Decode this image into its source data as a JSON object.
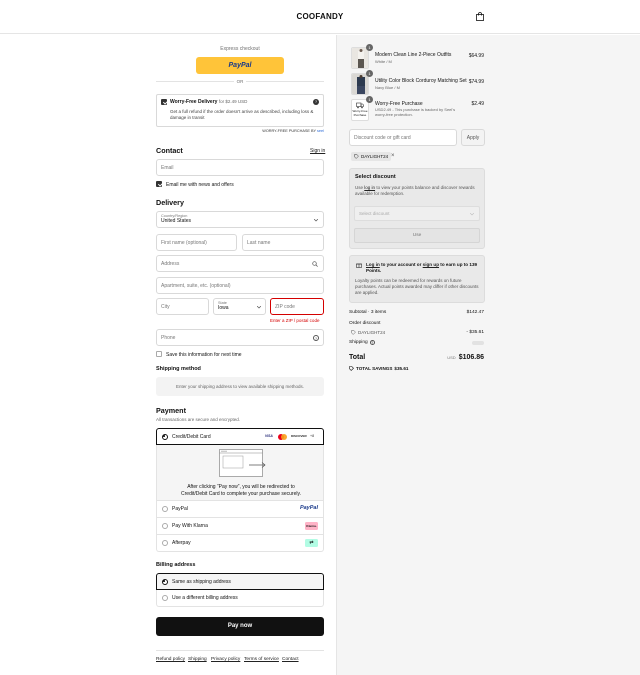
{
  "header": {
    "brand": "COOFANDY",
    "cart_icon": "shopping-bag-icon"
  },
  "express": {
    "label": "Express checkout",
    "paypal_label": "PayPal",
    "or": "OR"
  },
  "worry": {
    "title": "Worry-Free Delivery",
    "price": "for $2.49 USD",
    "desc": "Get a full refund if the order doesn't arrive as described, including loss & damage in transit",
    "powered": "WORRY-FREE PURCHASE BY",
    "seel": "seel",
    "checked": true
  },
  "contact": {
    "title": "Contact",
    "signin": "Sign in",
    "email_placeholder": "Email",
    "news_label": "Email me with news and offers",
    "news_checked": true
  },
  "delivery": {
    "title": "Delivery",
    "country_label": "Country/Region",
    "country_value": "United States",
    "first_name": "First name (optional)",
    "last_name": "Last name",
    "address": "Address",
    "apartment": "Apartment, suite, etc. (optional)",
    "city": "City",
    "state_label": "State",
    "state_value": "Iowa",
    "zip": "ZIP code",
    "zip_error": "Enter a ZIP / postal code",
    "phone": "Phone",
    "save_label": "Save this information for next time"
  },
  "shipping": {
    "title": "Shipping method",
    "message": "Enter your shipping address to view available shipping methods."
  },
  "payment": {
    "title": "Payment",
    "subtitle": "All transactions are secure and encrypted.",
    "card_label": "Credit/Debit Card",
    "card_badges": [
      "VISA",
      "MC",
      "DISCOVER",
      "+8"
    ],
    "redirect_text_1": "After clicking “Pay now”, you will be redirected to",
    "redirect_text_2": "Credit/Debit Card to complete your purchase securely.",
    "paypal": "PayPal",
    "paypal_logo": "PayPal",
    "klarna": "Pay With Klarna",
    "klarna_logo": "Klarna.",
    "afterpay": "Afterpay",
    "afterpay_logo": "⇄"
  },
  "billing": {
    "title": "Billing address",
    "same": "Same as shipping address",
    "different": "Use a different billing address"
  },
  "pay_button": "Pay now",
  "footer": [
    "Refund policy",
    "Shipping",
    "Privacy policy",
    "Terms of service",
    "Contact"
  ],
  "cart": {
    "items": [
      {
        "qty": "1",
        "name": "Modern Clean Line 2-Piece Outfits",
        "variant": "White / M",
        "price": "$64.99"
      },
      {
        "qty": "1",
        "name": "Utility Color Block Corduroy Matching Set",
        "variant": "Navy Blue / M",
        "price": "$74.99"
      },
      {
        "qty": "1",
        "name": "Worry-Free Purchase",
        "variant": "USD2.49 - This purchase is backed by Seel's worry-free protection.",
        "price": "$2.49",
        "thumb_text": "Worry-Free Purchase"
      }
    ],
    "discount_placeholder": "Discount code or gift card",
    "apply": "Apply",
    "code": "DAYLIGHT24",
    "select_discount": {
      "title": "Select discount",
      "text_pre": "Use",
      "login": "log in",
      "text_post": "to view your points balance and discover rewards available for redemption.",
      "select_placeholder": "Select discount",
      "use": "Use"
    },
    "points": {
      "login": "Log in",
      "text1": "to your account or",
      "signup": "sign up",
      "text2": "to earn up to 139 Points.",
      "desc": "Loyalty points can be redeemed for rewards on future purchases. Actual points awarded may differ if other discounts are applied."
    },
    "subtotal_label": "Subtotal · 3 items",
    "subtotal": "$142.47",
    "order_discount": "Order discount",
    "discount_code": "DAYLIGHT24",
    "discount_value": "- $35.61",
    "shipping_label": "Shipping",
    "total_label": "Total",
    "currency": "USD",
    "total": "$106.86",
    "savings_label": "TOTAL SAVINGS",
    "savings": "$35.61"
  },
  "colors": {
    "paypal_yellow": "#ffc439",
    "error": "#d40000",
    "dark": "#111111"
  }
}
